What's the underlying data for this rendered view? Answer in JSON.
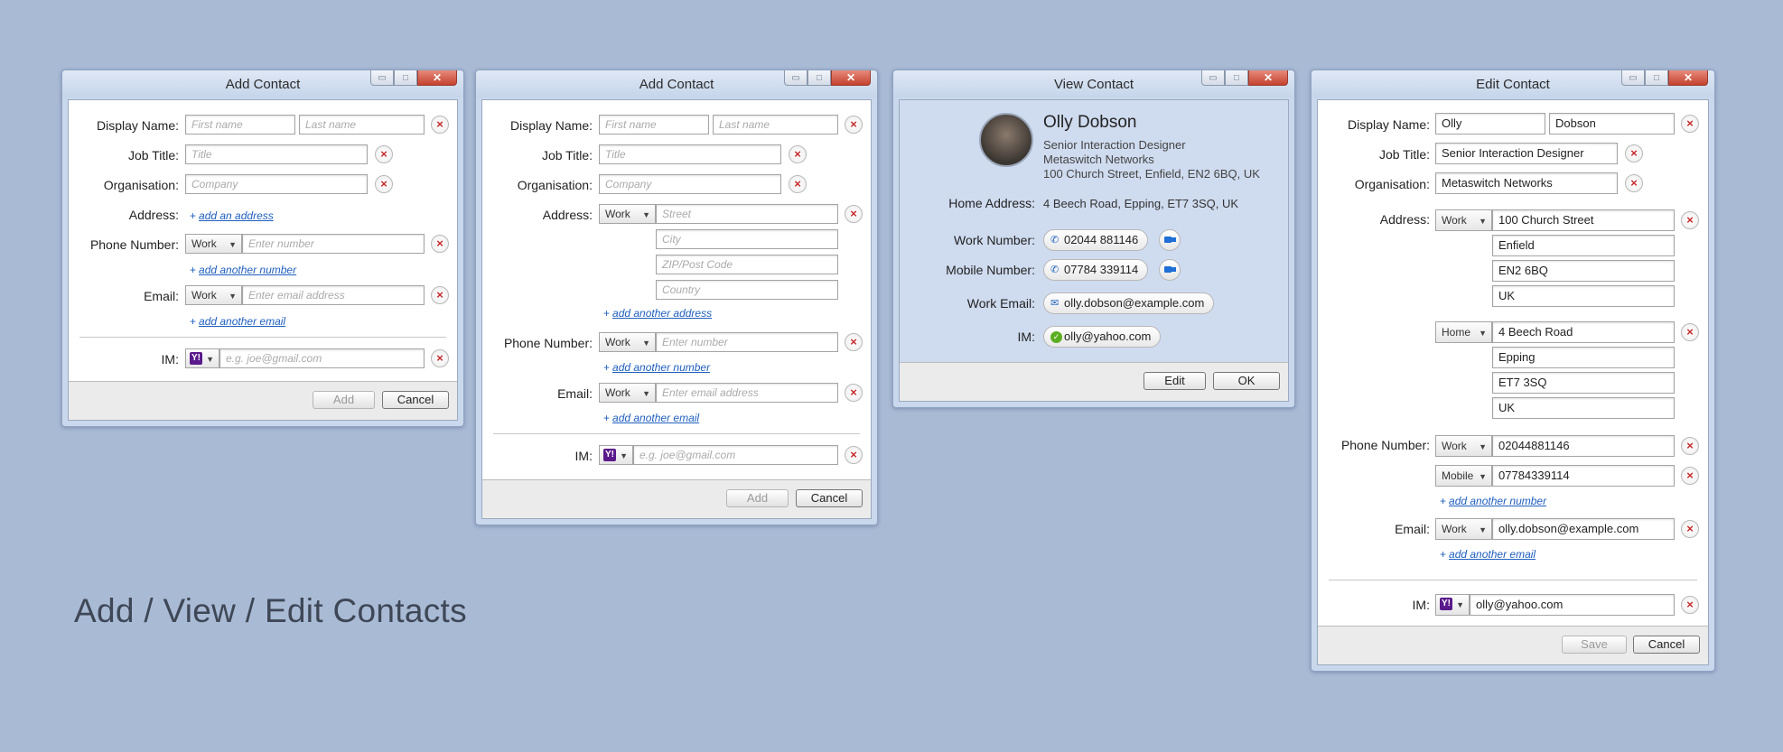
{
  "heading": "Add / View / Edit Contacts",
  "add1": {
    "title": "Add Contact",
    "display_name_label": "Display Name:",
    "first_name_ph": "First name",
    "last_name_ph": "Last name",
    "job_title_label": "Job Title:",
    "job_title_ph": "Title",
    "org_label": "Organisation:",
    "org_ph": "Company",
    "address_label": "Address:",
    "add_address": "add an address",
    "phone_label": "Phone Number:",
    "phone_type": "Work",
    "phone_ph": "Enter number",
    "add_number": "add another number",
    "email_label": "Email:",
    "email_type": "Work",
    "email_ph": "Enter email address",
    "add_email": "add another email",
    "im_label": "IM:",
    "im_ph": "e.g. joe@gmail.com",
    "add_btn": "Add",
    "cancel_btn": "Cancel"
  },
  "add2": {
    "title": "Add Contact",
    "display_name_label": "Display Name:",
    "first_name_ph": "First name",
    "last_name_ph": "Last name",
    "job_title_label": "Job Title:",
    "job_title_ph": "Title",
    "org_label": "Organisation:",
    "org_ph": "Company",
    "address_label": "Address:",
    "address_type": "Work",
    "street_ph": "Street",
    "city_ph": "City",
    "zip_ph": "ZIP/Post Code",
    "country_ph": "Country",
    "add_address": "add another address",
    "phone_label": "Phone Number:",
    "phone_type": "Work",
    "phone_ph": "Enter number",
    "add_number": "add another number",
    "email_label": "Email:",
    "email_type": "Work",
    "email_ph": "Enter email address",
    "add_email": "add another email",
    "im_label": "IM:",
    "im_ph": "e.g. joe@gmail.com",
    "add_btn": "Add",
    "cancel_btn": "Cancel"
  },
  "view": {
    "title": "View Contact",
    "name": "Olly Dobson",
    "job": "Senior Interaction Designer",
    "org": "Metaswitch Networks",
    "work_address": "100 Church Street, Enfield, EN2 6BQ, UK",
    "home_address_label": "Home Address:",
    "home_address": "4 Beech Road, Epping, ET7 3SQ, UK",
    "work_number_label": "Work Number:",
    "work_number": "02044 881146",
    "mobile_number_label": "Mobile Number:",
    "mobile_number": "07784 339114",
    "work_email_label": "Work Email:",
    "work_email": "olly.dobson@example.com",
    "im_label": "IM:",
    "im": "olly@yahoo.com",
    "edit_btn": "Edit",
    "ok_btn": "OK"
  },
  "edit": {
    "title": "Edit Contact",
    "display_name_label": "Display Name:",
    "first_name": "Olly",
    "last_name": "Dobson",
    "job_title_label": "Job Title:",
    "job_title": "Senior Interaction Designer",
    "org_label": "Organisation:",
    "org": "Metaswitch Networks",
    "address_label": "Address:",
    "addr1_type": "Work",
    "addr1": [
      "100 Church Street",
      "Enfield",
      "EN2 6BQ",
      "UK"
    ],
    "addr2_type": "Home",
    "addr2": [
      "4 Beech Road",
      "Epping",
      "ET7 3SQ",
      "UK"
    ],
    "phone_label": "Phone Number:",
    "phone1_type": "Work",
    "phone1": "02044881146",
    "phone2_type": "Mobile",
    "phone2": "07784339114",
    "add_number": "add another number",
    "email_label": "Email:",
    "email_type": "Work",
    "email": "olly.dobson@example.com",
    "add_email": "add another email",
    "im_label": "IM:",
    "im": "olly@yahoo.com",
    "save_btn": "Save",
    "cancel_btn": "Cancel"
  },
  "icons": {
    "remove": "×",
    "caret": "▼",
    "min": "▭",
    "max": "□",
    "close": "✕",
    "phone": "✆",
    "mail": "✉",
    "check": "✓",
    "yahoo": "Y!"
  }
}
